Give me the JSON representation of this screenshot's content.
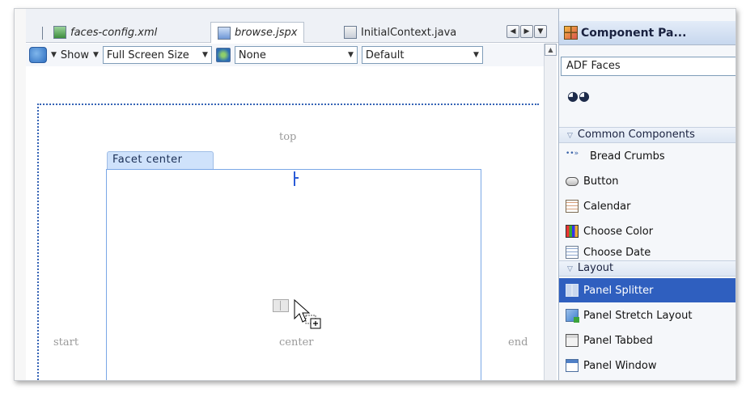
{
  "editor_tabs": [
    {
      "label": "faces-config.xml",
      "icon": "faces-config-icon",
      "italic": true
    },
    {
      "label": "browse.jspx",
      "icon": "jspx-file-icon",
      "italic": true,
      "active": true
    },
    {
      "label": "InitialContext.java",
      "icon": "java-file-icon",
      "italic": false
    }
  ],
  "tab_nav": [
    "◀",
    "▶",
    "▼"
  ],
  "toolbar": {
    "show_label": "Show",
    "screen_size": "Full Screen Size",
    "skin": "None",
    "style": "Default"
  },
  "canvas": {
    "facet_top": "top",
    "facet_start": "start",
    "facet_center": "center",
    "facet_end": "end",
    "facet_tab": "Facet  center"
  },
  "palette": {
    "title": "Component Pa...",
    "library": "ADF Faces",
    "sections": [
      {
        "label": "Common Components"
      },
      {
        "label": "Layout"
      }
    ],
    "common_items": [
      {
        "label": "Bread Crumbs",
        "icon": "bread-crumbs-icon"
      },
      {
        "label": "Button",
        "icon": "button-icon"
      },
      {
        "label": "Calendar",
        "icon": "calendar-icon"
      },
      {
        "label": "Choose Color",
        "icon": "choose-color-icon"
      },
      {
        "label": "Choose Date",
        "icon": "choose-date-icon"
      }
    ],
    "layout_items": [
      {
        "label": "Panel Splitter",
        "icon": "panel-splitter-icon",
        "selected": true
      },
      {
        "label": "Panel Stretch Layout",
        "icon": "panel-stretch-layout-icon"
      },
      {
        "label": "Panel Tabbed",
        "icon": "panel-tabbed-icon"
      },
      {
        "label": "Panel Window",
        "icon": "panel-window-icon"
      }
    ]
  },
  "colors": {
    "selection": "#2f5fbf",
    "facet_border": "#7aa7e6",
    "dotted_border": "#3563b5"
  }
}
